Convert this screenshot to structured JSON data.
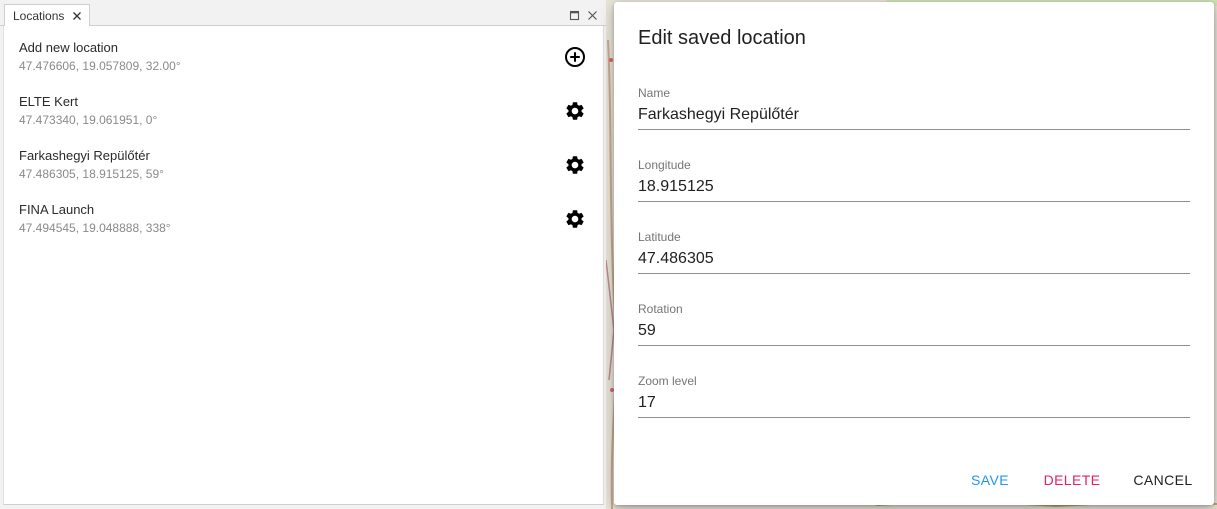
{
  "panel": {
    "tab_label": "Locations",
    "items": [
      {
        "name": "Add new location",
        "coords": "47.476606, 19.057809, 32.00°",
        "action_icon": "add-circle-icon"
      },
      {
        "name": "ELTE Kert",
        "coords": "47.473340, 19.061951, 0°",
        "action_icon": "gear-icon"
      },
      {
        "name": "Farkashegyi Repülőtér",
        "coords": "47.486305, 18.915125, 59°",
        "action_icon": "gear-icon"
      },
      {
        "name": "FINA Launch",
        "coords": "47.494545, 19.048888, 338°",
        "action_icon": "gear-icon"
      }
    ]
  },
  "dialog": {
    "title": "Edit saved location",
    "fields": [
      {
        "label": "Name",
        "value": "Farkashegyi Repülőtér"
      },
      {
        "label": "Longitude",
        "value": "18.915125"
      },
      {
        "label": "Latitude",
        "value": "47.486305"
      },
      {
        "label": "Rotation",
        "value": "59"
      },
      {
        "label": "Zoom level",
        "value": "17"
      }
    ],
    "buttons": {
      "save": "SAVE",
      "delete": "DELETE",
      "cancel": "CANCEL"
    }
  },
  "colors": {
    "save": "#2196f3",
    "delete": "#e91e63",
    "cancel": "#212121",
    "map_bg": "#e9e4d8"
  }
}
